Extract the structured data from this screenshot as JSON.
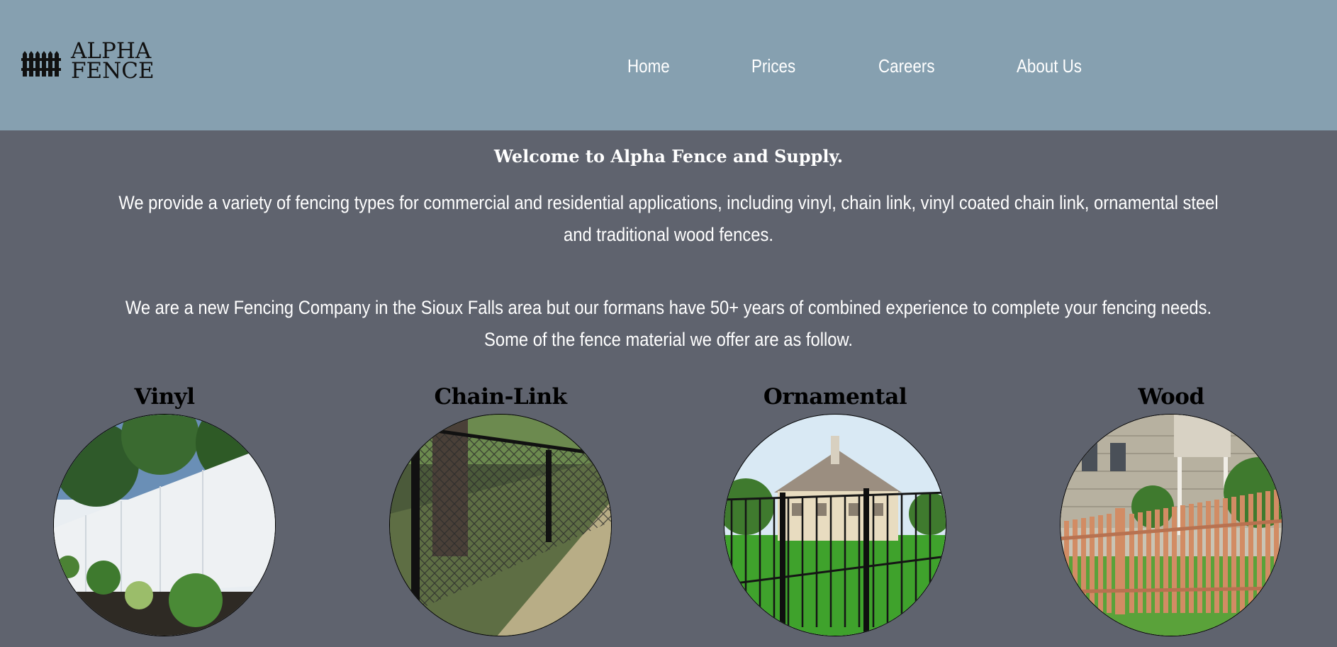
{
  "header": {
    "logo": {
      "icon": "fence-icon",
      "line1": "ALPHA",
      "line2": "FENCE"
    },
    "nav": [
      {
        "label": "Home"
      },
      {
        "label": "Prices"
      },
      {
        "label": "Careers"
      },
      {
        "label": "About Us"
      }
    ],
    "background_color": "#86a0b0"
  },
  "main": {
    "background_color": "#5f636e",
    "welcome": "Welcome to Alpha Fence and Supply.",
    "paragraph1": "We provide a variety of fencing types for commercial and residential applications, including vinyl, chain link, vinyl coated chain link, ornamental steel and traditional wood fences.",
    "paragraph2": "We are a new Fencing Company in the Sioux Falls area but our formans have 50+ years of combined experience to complete your fencing needs. Some of the fence material we offer are as follow.",
    "fence_types": [
      {
        "title": "Vinyl",
        "image": "vinyl-fence-photo"
      },
      {
        "title": "Chain-Link",
        "image": "chain-link-fence-photo"
      },
      {
        "title": "Ornamental",
        "image": "ornamental-fence-photo"
      },
      {
        "title": "Wood",
        "image": "wood-fence-photo"
      }
    ]
  }
}
